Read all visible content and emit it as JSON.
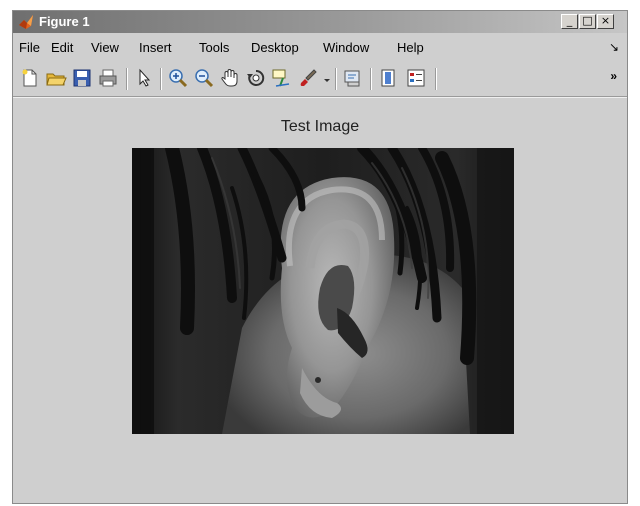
{
  "window": {
    "title": "Figure 1"
  },
  "window_controls": {
    "minimize": "_",
    "maximize": "□",
    "close": "×"
  },
  "menubar": {
    "items": [
      "File",
      "Edit",
      "View",
      "Insert",
      "Tools",
      "Desktop",
      "Window",
      "Help"
    ],
    "dock_arrow": "↘"
  },
  "toolbar": {
    "buttons": [
      "new-figure",
      "open-file",
      "save-figure",
      "print-figure",
      "edit-plot-arrow",
      "zoom-in",
      "zoom-out",
      "pan-hand",
      "rotate-3d",
      "data-cursor",
      "brush-data",
      "link-plot",
      "insert-colorbar",
      "insert-legend"
    ],
    "overflow": "»"
  },
  "axes": {
    "title": "Test Image"
  },
  "image": {
    "subject": "grayscale photograph of a human ear partly covered by dark hair"
  },
  "colors": {
    "titlebar": "#7a7a7a",
    "figure_bg": "#cfcfcf"
  }
}
